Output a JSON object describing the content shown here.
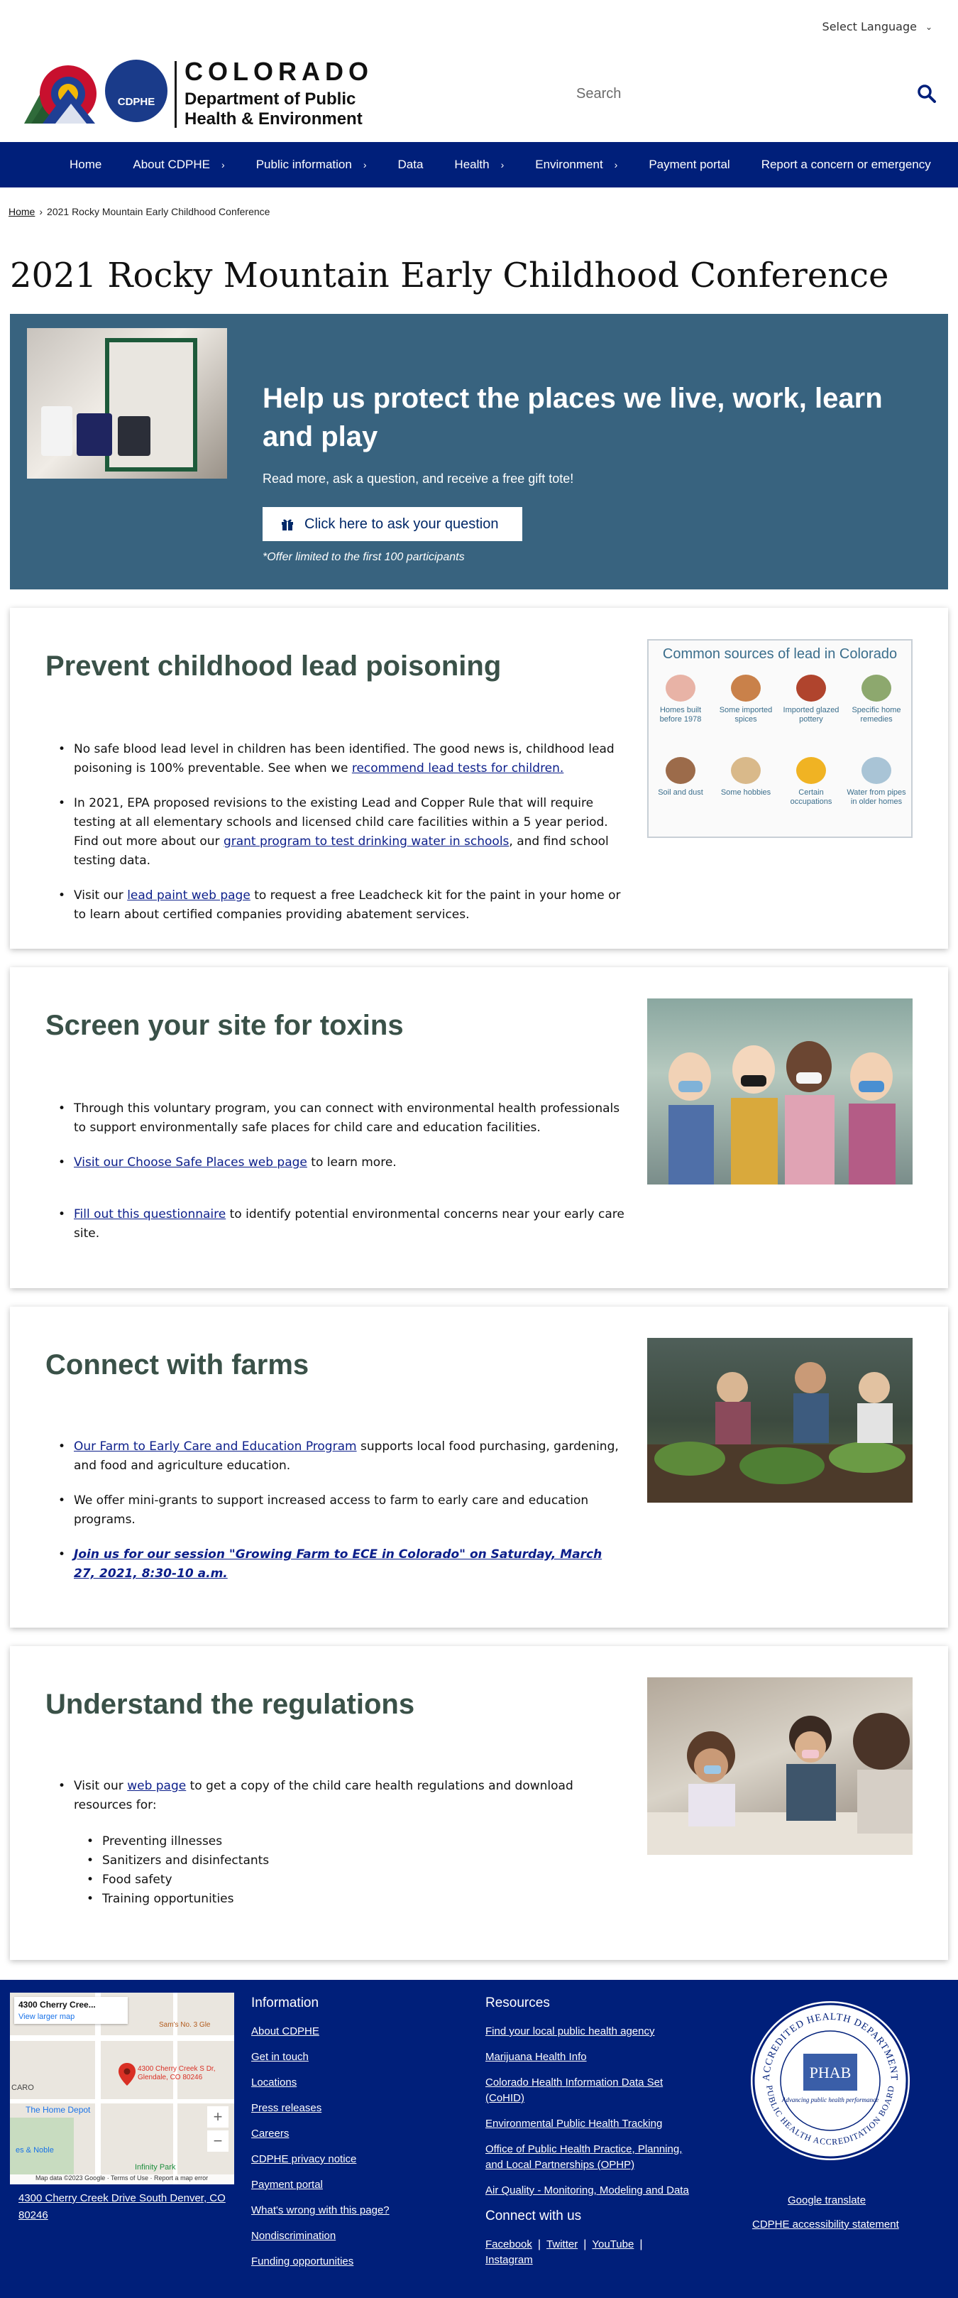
{
  "language": {
    "label": "Select Language"
  },
  "header": {
    "brand_colorado": "COLORADO",
    "brand_dept_line1": "Department of Public",
    "brand_dept_line2": "Health & Environment",
    "cdphe_badge": "CDPHE",
    "search_placeholder": "Search"
  },
  "nav": {
    "items": [
      {
        "label": "Home"
      },
      {
        "label": "About CDPHE"
      },
      {
        "label": "Public information"
      },
      {
        "label": "Data"
      },
      {
        "label": "Health"
      },
      {
        "label": "Environment"
      },
      {
        "label": "Payment portal"
      },
      {
        "label": "Report a concern or emergency"
      }
    ]
  },
  "breadcrumb": {
    "home": "Home",
    "current": "2021 Rocky Mountain Early Childhood Conference"
  },
  "page_title": "2021 Rocky Mountain Early Childhood Conference",
  "promo": {
    "headline": "Help us protect the places we live, work, learn and play",
    "subtext": "Read more, ask a question, and receive a free gift tote!",
    "button_label": "Click here to ask your question",
    "note": "*Offer limited to the first 100 participants"
  },
  "lead": {
    "title": "Prevent childhood lead poisoning",
    "b1_text": "No safe blood lead level in children has been identified. The good news is, childhood lead poisoning is 100% preventable. See when we ",
    "b1_link": "recommend lead tests for children.",
    "b2_text1": "In 2021, EPA proposed revisions to the existing Lead and Copper Rule that will require testing at all elementary schools and licensed child care facilities within a 5 year period. Find out more about our ",
    "b2_link": "grant program to test drinking water in schools",
    "b2_text2": ", and find school testing data.",
    "b3_text1": "Visit our ",
    "b3_link": "lead paint web page",
    "b3_text2": " to request a free Leadcheck kit for the paint in your home or to learn about certified companies providing abatement services.",
    "graphic": {
      "title": "Common sources of lead in Colorado",
      "items": [
        {
          "label": "Homes built before 1978"
        },
        {
          "label": "Some imported spices"
        },
        {
          "label": "Imported glazed pottery"
        },
        {
          "label": "Specific home remedies"
        },
        {
          "label": "Soil and dust"
        },
        {
          "label": "Some hobbies"
        },
        {
          "label": "Certain occupations"
        },
        {
          "label": "Water from pipes in older homes"
        }
      ]
    }
  },
  "toxins": {
    "title": "Screen your site for toxins",
    "b1": "Through this voluntary program, you can connect with environmental health professionals to support environmentally safe places for child care and education facilities.",
    "b2_link": "Visit our Choose Safe Places web page",
    "b2_text": " to learn more.",
    "b3_link": "Fill out this questionnaire",
    "b3_text": " to identify potential environmental concerns near your early care site."
  },
  "farms": {
    "title": "Connect with farms",
    "b1_link": "Our Farm to Early Care and Education Program",
    "b1_text": " supports local food purchasing, gardening, and food and agriculture education.",
    "b2": "We offer mini-grants to support increased access to farm to early care and education programs.",
    "b3_link": "Join us for our session \"Growing Farm to ECE in Colorado\" on Saturday, March 27, 2021, 8:30-10 a.m."
  },
  "regulations": {
    "title": "Understand the regulations",
    "b1_text1": "Visit our ",
    "b1_link": "web page",
    "b1_text2": " to get a copy of the child care health regulations and download resources for:",
    "sub": [
      "Preventing illnesses",
      "Sanitizers and disinfectants",
      "Food safety",
      "Training opportunities"
    ]
  },
  "footer": {
    "map": {
      "place_label": "4300 Cherry Cree...",
      "larger_map": "View larger map",
      "pin_label": "4300 Cherry Creek S Dr, Glendale, CO 80246",
      "poi_home_depot": "The Home Depot",
      "poi_sams": "Sam's No. 3 Gle",
      "poi_noble": "es & Noble",
      "poi_infinity": "Infinity Park",
      "street_caro": "CARO",
      "attribution": "Map data ©2023 Google · Terms of Use · Report a map error"
    },
    "address": "4300 Cherry Creek Drive South Denver, CO 80246",
    "information": {
      "heading": "Information",
      "links": [
        "About CDPHE",
        "Get in touch",
        "Locations",
        "Press releases",
        "Careers",
        "CDPHE privacy notice",
        "Payment portal",
        "What's wrong with this page?",
        "Nondiscrimination",
        "Funding opportunities"
      ]
    },
    "resources": {
      "heading": "Resources",
      "links": [
        "Find your local public health agency",
        "Marijuana Health Info",
        "Colorado Health Information Data Set (CoHID)",
        "Environmental Public Health Tracking",
        "Office of Public Health Practice, Planning, and Local Partnerships (OPHP)",
        "Air Quality - Monitoring, Modeling and Data"
      ]
    },
    "connect": {
      "heading": "Connect with us",
      "facebook": "Facebook",
      "twitter": "Twitter",
      "youtube": "YouTube",
      "instagram": "Instagram"
    },
    "seal": {
      "ring_top": "ACCREDITED HEALTH DEPARTMENT",
      "ring_bottom": "PUBLIC HEALTH ACCREDITATION BOARD",
      "center": "PHAB",
      "tagline": "Advancing public health performance"
    },
    "google_translate": "Google translate",
    "accessibility": "CDPHE accessibility statement"
  }
}
